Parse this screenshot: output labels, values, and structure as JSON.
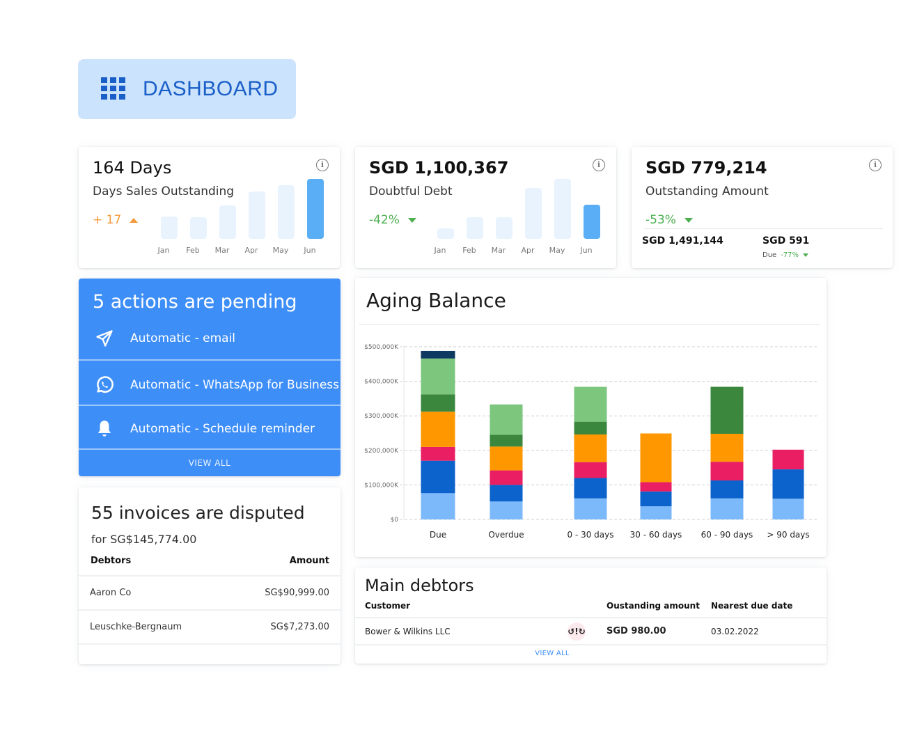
{
  "header": {
    "title": "DASHBOARD",
    "icon": "grid-icon"
  },
  "kpis": [
    {
      "value": "164 Days",
      "label": "Days Sales Outstanding",
      "delta": "+ 17",
      "delta_direction": "up",
      "months": [
        "Jan",
        "Feb",
        "Mar",
        "Apr",
        "May",
        "Jun"
      ],
      "relative_values": [
        0.37,
        0.36,
        0.56,
        0.79,
        0.9,
        1.0
      ],
      "active_index": 5
    },
    {
      "value": "SGD 1,100,367",
      "label": "Doubtful Debt",
      "delta": "-42%",
      "delta_direction": "down",
      "months": [
        "Jan",
        "Feb",
        "Mar",
        "Apr",
        "May",
        "Jun"
      ],
      "relative_values": [
        0.17,
        0.36,
        0.36,
        0.85,
        1.0,
        0.57
      ],
      "active_index": 5
    },
    {
      "value": "SGD 779,214",
      "label": "Outstanding Amount",
      "delta": "-53%",
      "delta_direction": "down",
      "sub_total": "SGD 1,491,144",
      "sub_due": "SGD 591",
      "sub_due_label": "Due",
      "sub_due_delta": "-77%"
    }
  ],
  "actions": {
    "title": "5 actions are pending",
    "items": [
      {
        "label": "Automatic - email",
        "icon": "send-icon"
      },
      {
        "label": "Automatic - WhatsApp for Business",
        "icon": "whatsapp-icon"
      },
      {
        "label": "Automatic - Schedule reminder",
        "icon": "bell-icon"
      }
    ],
    "view_all": "VIEW ALL"
  },
  "disputed": {
    "title": "55 invoices are disputed",
    "subtitle": "for SG$145,774.00",
    "columns": [
      "Debtors",
      "Amount"
    ],
    "rows": [
      {
        "debtor": "Aaron Co",
        "amount": "SG$90,999.00"
      },
      {
        "debtor": "Leuschke-Bergnaum",
        "amount": "SG$7,273.00"
      }
    ]
  },
  "aging": {
    "title": "Aging Balance"
  },
  "chart_data": {
    "type": "bar",
    "stacked": true,
    "title": "Aging Balance",
    "xlabel": "",
    "ylabel": "",
    "ylim": [
      0,
      500000
    ],
    "yticks": [
      "$0",
      "$100,000K",
      "$200,000K",
      "$300,000K",
      "$400,000K",
      "$500,000K"
    ],
    "grid": true,
    "categories": [
      "Due",
      "Overdue",
      "0 - 30 days",
      "30 - 60 days",
      "60 - 90 days",
      "> 90 days"
    ],
    "series": [
      {
        "name": "series-1",
        "color": "#7cb9fb",
        "values": [
          76000,
          52000,
          61000,
          38000,
          61000,
          60000
        ]
      },
      {
        "name": "series-2",
        "color": "#0d63cc",
        "values": [
          94000,
          48000,
          59000,
          43000,
          52000,
          85000
        ]
      },
      {
        "name": "series-3",
        "color": "#e91e63",
        "values": [
          40000,
          42000,
          46000,
          27000,
          54000,
          57000
        ]
      },
      {
        "name": "series-4",
        "color": "#ff9800",
        "values": [
          102000,
          69000,
          80000,
          141000,
          81000,
          0
        ]
      },
      {
        "name": "series-5",
        "color": "#3b873e",
        "values": [
          50000,
          34000,
          37000,
          0,
          136000,
          0
        ]
      },
      {
        "name": "series-6",
        "color": "#7cc67e",
        "values": [
          104000,
          88000,
          101000,
          0,
          0,
          0
        ]
      },
      {
        "name": "series-7",
        "color": "#0e3a62",
        "values": [
          22000,
          0,
          0,
          0,
          0,
          0
        ]
      }
    ]
  },
  "debtors": {
    "title": "Main debtors",
    "columns": [
      "Customer",
      "Oustanding amount",
      "Nearest due date"
    ],
    "rows": [
      {
        "customer": "Bower & Wilkins LLC",
        "status_icon": "dispute-icon",
        "status_glyph": "↺!↻",
        "amount": "SGD 980.00",
        "due_date": "03.02.2022"
      }
    ],
    "view_all": "VIEW ALL"
  },
  "colors": {
    "accent": "#3e8ef7",
    "header_bg": "#cce3fd",
    "header_text": "#1a5fc8",
    "positive": "#4caf50",
    "warning": "#f39a3a",
    "spark_active": "#5aaef5",
    "spark_inactive": "#e8f3fe"
  }
}
